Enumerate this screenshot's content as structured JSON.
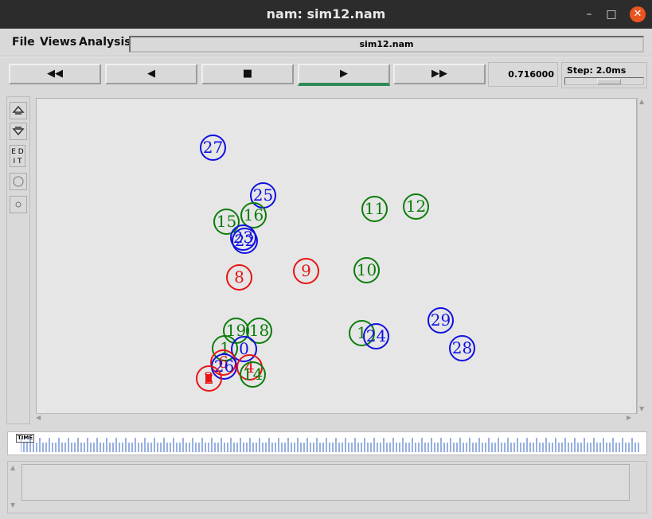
{
  "window": {
    "title": "nam: sim12.nam",
    "minimize": "–",
    "maximize": "□",
    "close": "✕"
  },
  "menu": {
    "file": "File",
    "views": "Views",
    "analysis": "Analysis"
  },
  "filename": "sim12.nam",
  "controls": {
    "rewind": "◀◀",
    "back": "◀",
    "stop": "■",
    "play": "▶",
    "fastforward": "▶▶",
    "time": "0.716000",
    "step_label": "Step: 2.0ms"
  },
  "tools": {
    "zoom_in_icon": "zoom-in-icon",
    "zoom_out_icon": "zoom-out-icon",
    "edit_label": "E D\nI T"
  },
  "timeline": {
    "label": "TIME"
  },
  "nodes": [
    {
      "id": "27",
      "color": "blue"
    },
    {
      "id": "25",
      "color": "blue"
    },
    {
      "id": "16",
      "color": "green"
    },
    {
      "id": "15",
      "color": "green"
    },
    {
      "id": "23",
      "color": "blue"
    },
    {
      "id": "22",
      "color": "blue"
    },
    {
      "id": "11",
      "color": "green"
    },
    {
      "id": "12",
      "color": "green"
    },
    {
      "id": "8",
      "color": "red"
    },
    {
      "id": "9",
      "color": "red"
    },
    {
      "id": "10",
      "color": "green"
    },
    {
      "id": "19",
      "color": "green"
    },
    {
      "id": "18",
      "color": "green"
    },
    {
      "id": "1",
      "color": "green"
    },
    {
      "id": "0",
      "color": "blue"
    },
    {
      "id": "6",
      "color": "red"
    },
    {
      "id": "26",
      "color": "blue"
    },
    {
      "id": "4",
      "color": "red"
    },
    {
      "id": "14",
      "color": "green"
    },
    {
      "id": "2",
      "color": "red"
    },
    {
      "id": "1",
      "color": "green"
    },
    {
      "id": "24",
      "color": "blue"
    },
    {
      "id": "29",
      "color": "blue"
    },
    {
      "id": "28",
      "color": "blue"
    }
  ],
  "colors": {
    "blue": "#1010e0",
    "green": "#0b7d0b",
    "red": "#e81414",
    "play_active": "#2e8b57"
  }
}
